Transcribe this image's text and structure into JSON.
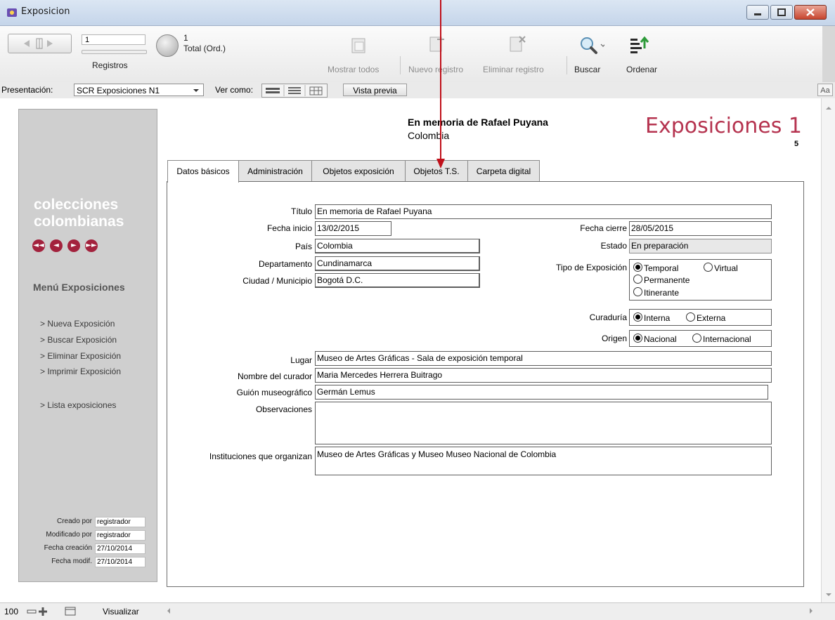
{
  "window": {
    "title": "Exposicion"
  },
  "toolbar": {
    "record_value": "1",
    "records_label": "Registros",
    "found_count": "1",
    "total_label": "Total (Ord.)",
    "show_all": "Mostrar todos",
    "new_record": "Nuevo registro",
    "delete_record": "Eliminar registro",
    "search": "Buscar",
    "sort": "Ordenar"
  },
  "presbar": {
    "layout_label": "Presentación:",
    "layout_value": "SCR Exposiciones N1",
    "view_as_label": "Ver como:",
    "preview_button": "Vista previa",
    "font_button": "Aa"
  },
  "header": {
    "record_title": "En memoria de Rafael Puyana",
    "record_country": "Colombia",
    "section_title": "Exposiciones 1",
    "record_number": "5"
  },
  "sidebar": {
    "logo_line1": "colecciones",
    "logo_line2": "colombianas",
    "menu_title": "Menú Exposiciones",
    "menu_items": [
      "> Nueva Exposición",
      "> Buscar Exposición",
      "> Eliminar Exposición",
      "> Imprimir Exposición",
      "> Lista exposiciones"
    ],
    "meta": [
      {
        "label": "Creado por",
        "value": "registrador"
      },
      {
        "label": "Modificado por",
        "value": "registrador"
      },
      {
        "label": "Fecha creación",
        "value": "27/10/2014"
      },
      {
        "label": "Fecha modif.",
        "value": "27/10/2014"
      }
    ]
  },
  "tabs": [
    "Datos básicos",
    "Administración",
    "Objetos exposición",
    "Objetos T.S.",
    "Carpeta digital"
  ],
  "form": {
    "titulo_label": "Título",
    "titulo": "En memoria de Rafael Puyana",
    "fecha_inicio_label": "Fecha inicio",
    "fecha_inicio": "13/02/2015",
    "fecha_cierre_label": "Fecha cierre",
    "fecha_cierre": "28/05/2015",
    "pais_label": "País",
    "pais": "Colombia",
    "estado_label": "Estado",
    "estado": "En preparación",
    "departamento_label": "Departamento",
    "departamento": "Cundinamarca",
    "ciudad_label": "Ciudad / Municipio",
    "ciudad": "Bogotá D.C.",
    "tipo_label": "Tipo de Exposición",
    "tipo_options": [
      "Temporal",
      "Virtual",
      "Permanente",
      "Itinerante"
    ],
    "tipo_selected": "Temporal",
    "curaduria_label": "Curaduría",
    "curaduria_options": [
      "Interna",
      "Externa"
    ],
    "curaduria_selected": "Interna",
    "origen_label": "Origen",
    "origen_options": [
      "Nacional",
      "Internacional"
    ],
    "origen_selected": "Nacional",
    "lugar_label": "Lugar",
    "lugar": "Museo de Artes Gráficas - Sala de exposición temporal",
    "curador_label": "Nombre del curador",
    "curador": "Maria Mercedes Herrera Buitrago",
    "guion_label": "Guión museográfico",
    "guion": "Germán Lemus",
    "observaciones_label": "Observaciones",
    "observaciones": "",
    "instituciones_label": "Instituciones que organizan",
    "instituciones": "Museo de Artes Gráficas y Museo Museo Nacional de Colombia"
  },
  "statusbar": {
    "zoom": "100",
    "mode": "Visualizar"
  },
  "colors": {
    "accent_red": "#a3223d",
    "section_title": "#b5334f",
    "arrow": "#c0101a"
  }
}
